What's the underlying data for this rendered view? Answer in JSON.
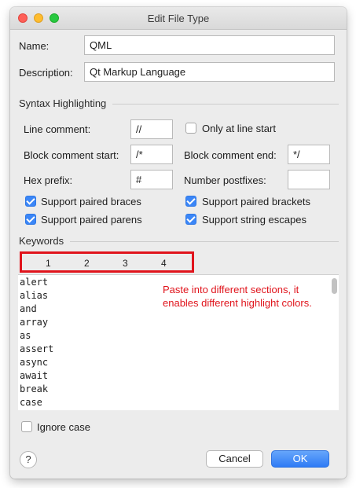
{
  "window": {
    "title": "Edit File Type"
  },
  "form": {
    "name_label": "Name:",
    "name_value": "QML",
    "description_label": "Description:",
    "description_value": "Qt Markup Language"
  },
  "syntax": {
    "section_title": "Syntax Highlighting",
    "line_comment_label": "Line comment:",
    "line_comment_value": "//",
    "only_line_start_label": "Only at line start",
    "only_line_start_checked": false,
    "block_start_label": "Block comment start:",
    "block_start_value": "/*",
    "block_end_label": "Block comment end:",
    "block_end_value": "*/",
    "hex_prefix_label": "Hex prefix:",
    "hex_prefix_value": "#",
    "number_postfixes_label": "Number postfixes:",
    "number_postfixes_value": "",
    "checks": [
      {
        "label": "Support paired braces",
        "checked": true
      },
      {
        "label": "Support paired brackets",
        "checked": true
      },
      {
        "label": "Support paired parens",
        "checked": true
      },
      {
        "label": "Support string escapes",
        "checked": true
      }
    ]
  },
  "keywords": {
    "section_title": "Keywords",
    "tabs": [
      "1",
      "2",
      "3",
      "4"
    ],
    "items": [
      "alert",
      "alias",
      "and",
      "array",
      "as",
      "assert",
      "async",
      "await",
      "break",
      "case"
    ],
    "annotation": "Paste into different sections, it enables different highlight colors."
  },
  "footer": {
    "ignore_case_label": "Ignore case",
    "ignore_case_checked": false,
    "help_label": "?",
    "cancel_label": "Cancel",
    "ok_label": "OK"
  },
  "colors": {
    "accent": "#3b86f7",
    "annotation_red": "#e0141c"
  }
}
